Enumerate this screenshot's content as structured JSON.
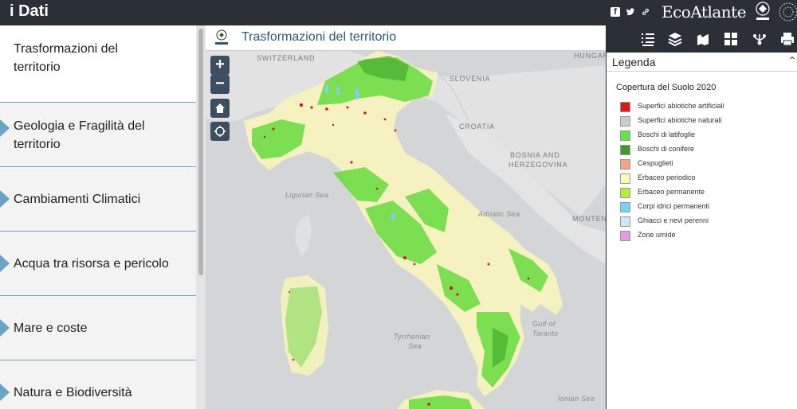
{
  "header": {
    "app_title": "i Dati",
    "brand_logo": "EcoAtlante",
    "icons": [
      "facebook-icon",
      "twitter-icon",
      "link-icon"
    ]
  },
  "sidebar": {
    "items": [
      {
        "label": "Trasformazioni del territorio",
        "active": true
      },
      {
        "label": "Geologia e Fragilità del territorio",
        "active": false
      },
      {
        "label": "Cambiamenti Climatici",
        "active": false
      },
      {
        "label": "Acqua tra risorsa e pericolo",
        "active": false
      },
      {
        "label": "Mare e coste",
        "active": false
      },
      {
        "label": "Natura e Biodiversità",
        "active": false
      }
    ]
  },
  "map": {
    "title": "Trasformazioni del territorio",
    "zoom_in": "+",
    "zoom_out": "−",
    "country_labels": [
      "SWITZERLAND",
      "HUNGARY",
      "SLOVENIA",
      "CROATIA",
      "BOSNIA AND",
      "HERZEGOVINA",
      "MONTENEGRO"
    ],
    "sea_labels": [
      "Ligurian Sea",
      "Adriatic Sea",
      "Tyrrhenian",
      "Sea",
      "Gulf of",
      "Taranto",
      "Ionian Sea"
    ]
  },
  "legend": {
    "panel_title": "Legenda",
    "subtitle": "Copertura del Suolo 2020",
    "items": [
      {
        "label": "Superfici abiotiche artificiali",
        "color": "#d7191c"
      },
      {
        "label": "Superfici abiotiche naturali",
        "color": "#cccccc"
      },
      {
        "label": "Boschi di latifoglie",
        "color": "#66e34a"
      },
      {
        "label": "Boschi di conifere",
        "color": "#3d9a2c"
      },
      {
        "label": "Cespuglieti",
        "color": "#f4a582"
      },
      {
        "label": "Erbaceo periodico",
        "color": "#fafab4"
      },
      {
        "label": "Erbaceo permanente",
        "color": "#b5ee3a"
      },
      {
        "label": "Corpi idrici permanenti",
        "color": "#7ad2f5"
      },
      {
        "label": "Ghiacci e nevi perenni",
        "color": "#cfe8f7"
      },
      {
        "label": "Zone umide",
        "color": "#e59be3"
      }
    ],
    "toolbar": [
      "legend-list-icon",
      "layers-icon",
      "basemap-icon",
      "gallery-icon",
      "share-icon",
      "print-icon"
    ]
  }
}
